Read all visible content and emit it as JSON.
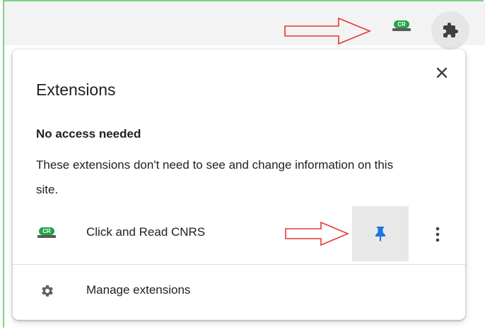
{
  "toolbar": {
    "extension_badge_text": "CR",
    "icons": [
      "red-arrow-icon",
      "click-and-read-icon",
      "puzzle-icon"
    ]
  },
  "popup": {
    "title": "Extensions",
    "section_heading": "No access needed",
    "section_description": "These extensions don't need to see and change information on this site.",
    "extensions": [
      {
        "name": "Click and Read CNRS",
        "icon": "click-and-read-icon",
        "pinned": true,
        "badge_text": "CR"
      }
    ],
    "manage_label": "Manage extensions"
  },
  "colors": {
    "pin_active": "#1a73e8",
    "annotation_arrow": "#e53935",
    "badge_green": "#22a447",
    "frame_green": "#7fd17f"
  }
}
